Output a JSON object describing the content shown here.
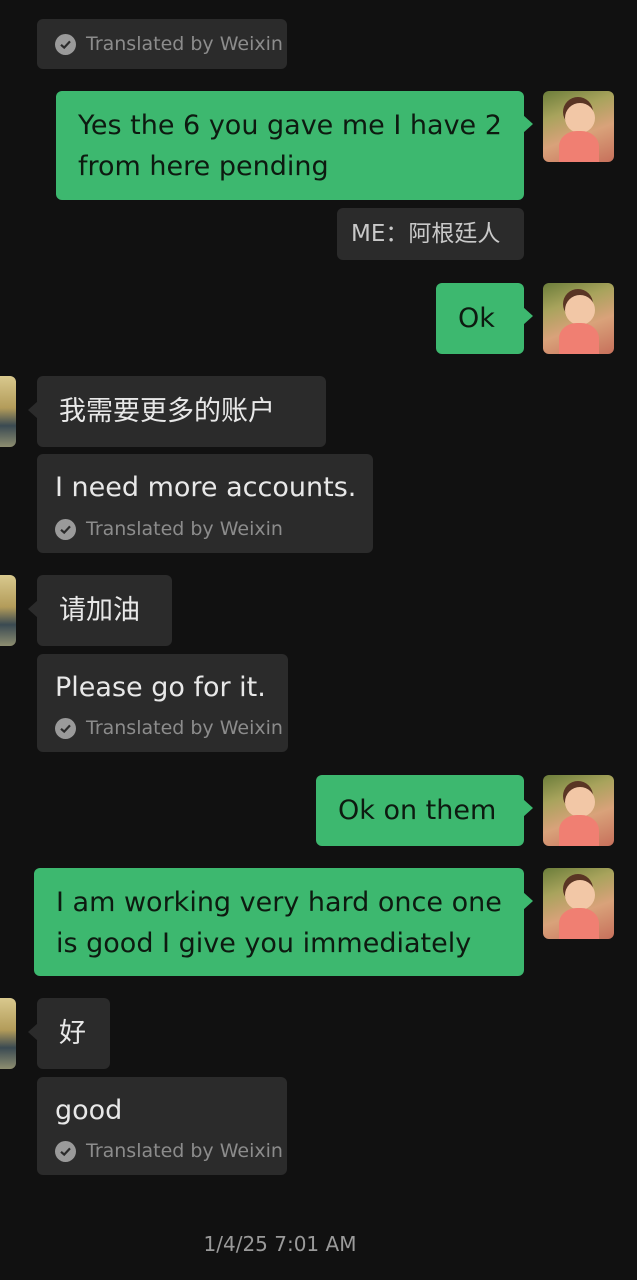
{
  "translation_label": "Translated by Weixin",
  "messages": {
    "m1_out": "Yes the 6 you gave me I have 2 from here pending",
    "m1_tag": "ME：阿根廷人",
    "m2_out": "Ok",
    "m3_in": "我需要更多的账户",
    "m3_trans": "I need more accounts.",
    "m4_in": "请加油",
    "m4_trans": "Please go for it.",
    "m5_out": "Ok on them",
    "m6_out": "I am working very hard once one is good I give you immediately",
    "m7_in": "好",
    "m7_trans": "good"
  },
  "timestamp": "1/4/25 7:01 AM",
  "colors": {
    "background": "#111111",
    "outgoing_bubble": "#3db86f",
    "incoming_bubble": "#2b2b2b"
  },
  "icons": {
    "translation_check": "check-circle-icon",
    "self_avatar": "avatar-girl",
    "contact_avatar": "avatar-landscape"
  }
}
